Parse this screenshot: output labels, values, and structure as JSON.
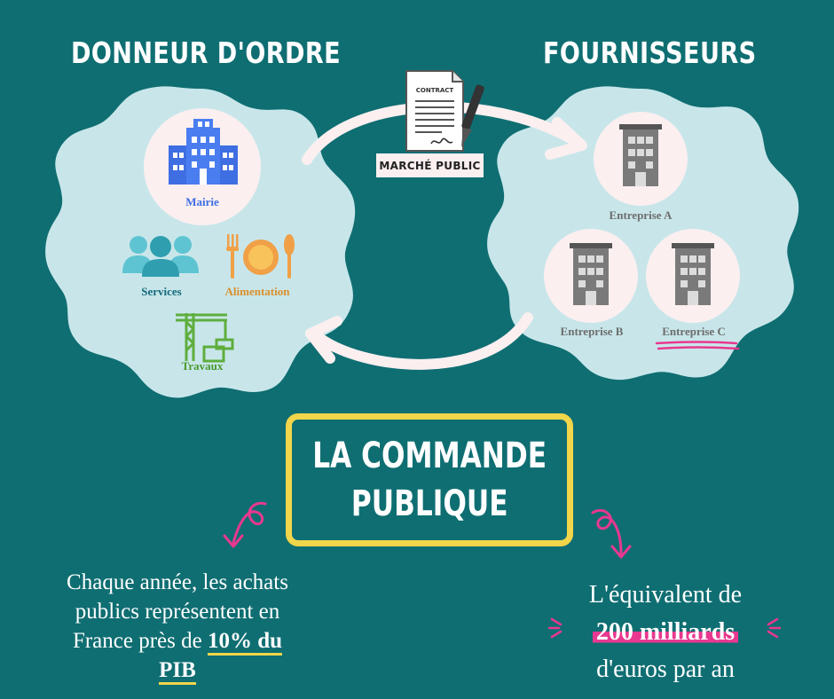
{
  "headings": {
    "left": "DONNEUR D'ORDRE",
    "right": "FOURNISSEURS"
  },
  "contract": {
    "doc_label": "CONTRACT",
    "tag": "MARCHÉ PUBLIC"
  },
  "buyer": {
    "main": "Mairie",
    "items": [
      "Services",
      "Alimentation",
      "Travaux"
    ]
  },
  "suppliers": [
    "Entreprise A",
    "Entreprise B",
    "Entreprise C"
  ],
  "title": {
    "line1": "LA COMMANDE",
    "line2": "PUBLIQUE"
  },
  "fact_left": {
    "line1": "Chaque année, les achats",
    "line2": "publics représentent en",
    "line3_pre": "France près de ",
    "line3_em": "10% du",
    "line4_em": "PIB"
  },
  "fact_right": {
    "line1": "L'équivalent de",
    "line2_em": "200 milliards",
    "line3": "d'euros par an"
  },
  "colors": {
    "background": "#0f6e72",
    "blob": "#c8e6ea",
    "circle": "#fbeff0",
    "accent_pink": "#e8388f",
    "accent_yellow": "#f1d54a",
    "building_blue": "#3f6ee3",
    "building_gray": "#7a7a7a",
    "services_teal": "#3aa6b7",
    "food_orange": "#f0a046",
    "works_green": "#5fae3e"
  },
  "icons": [
    "city-hall-icon",
    "people-icon",
    "plate-icon",
    "crane-icon",
    "building-icon",
    "contract-icon",
    "pen-icon",
    "arrow-icon"
  ]
}
